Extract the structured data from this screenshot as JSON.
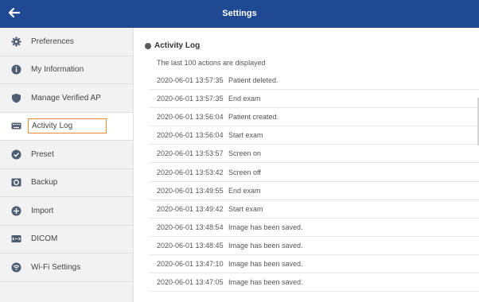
{
  "header": {
    "title": "Settings",
    "back_icon": "arrow-left-icon"
  },
  "colors": {
    "header_bg": "#1f4a93",
    "active_outline": "#f0883b",
    "icon": "#4f5d73"
  },
  "sidebar": {
    "items": [
      {
        "label": "Preferences",
        "icon": "gear-icon"
      },
      {
        "label": "My Information",
        "icon": "info-icon"
      },
      {
        "label": "Manage Verified AP",
        "icon": "shield-icon"
      },
      {
        "label": "Activity Log",
        "icon": "keyboard-icon",
        "active": true
      },
      {
        "label": "Preset",
        "icon": "check-circle-icon"
      },
      {
        "label": "Backup",
        "icon": "backup-icon"
      },
      {
        "label": "Import",
        "icon": "import-icon"
      },
      {
        "label": "DICOM",
        "icon": "dicom-icon"
      },
      {
        "label": "Wi-Fi Settings",
        "icon": "wifi-icon"
      }
    ]
  },
  "main": {
    "section_title": "Activity Log",
    "subtitle": "The last 100 actions are displayed",
    "log": [
      {
        "time": "2020-06-01 13:57:35",
        "text": "Patient deleted."
      },
      {
        "time": "2020-06-01 13:57:35",
        "text": "End exam"
      },
      {
        "time": "2020-06-01 13:56:04",
        "text": "Patient created."
      },
      {
        "time": "2020-06-01 13:56:04",
        "text": "Start exam"
      },
      {
        "time": "2020-06-01 13:53:57",
        "text": "Screen on"
      },
      {
        "time": "2020-06-01 13:53:42",
        "text": "Screen off"
      },
      {
        "time": "2020-06-01 13:49:55",
        "text": "End exam"
      },
      {
        "time": "2020-06-01 13:49:42",
        "text": "Start exam"
      },
      {
        "time": "2020-06-01 13:48:54",
        "text": "Image has been saved."
      },
      {
        "time": "2020-06-01 13:48:45",
        "text": "Image has been saved."
      },
      {
        "time": "2020-06-01 13:47:10",
        "text": "Image has been saved."
      },
      {
        "time": "2020-06-01 13:47:05",
        "text": "Image has been saved."
      }
    ]
  }
}
